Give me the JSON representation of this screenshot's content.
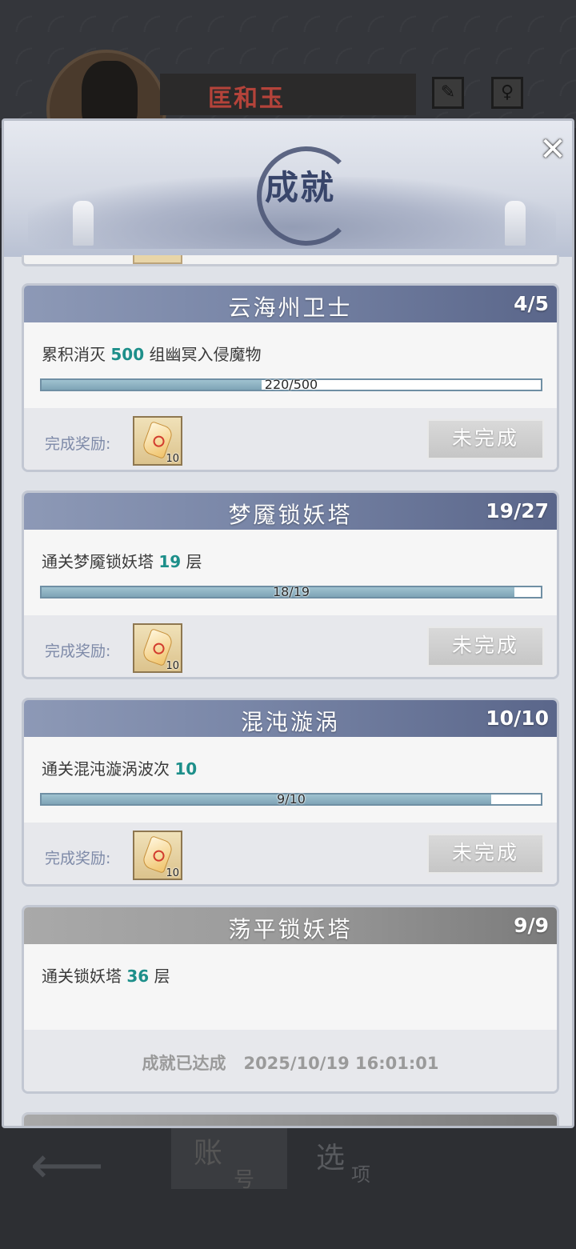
{
  "player": {
    "name": "匡和玉"
  },
  "dialog": {
    "title": "成就",
    "close_label": "✕"
  },
  "achievements": [
    {
      "title": "云海州卫士",
      "progress_count": "4/5",
      "desc_before": "累积消灭 ",
      "desc_number": "500",
      "desc_after": " 组幽冥入侵魔物",
      "progress_value": 220,
      "progress_max": 500,
      "progress_text": "220/500",
      "reward_label": "完成奖励:",
      "reward_qty": "10",
      "status": "未完成"
    },
    {
      "title": "梦魇锁妖塔",
      "progress_count": "19/27",
      "desc_before": "通关梦魇锁妖塔 ",
      "desc_number": "19",
      "desc_after": " 层",
      "progress_value": 18,
      "progress_max": 19,
      "progress_text": "18/19",
      "reward_label": "完成奖励:",
      "reward_qty": "10",
      "status": "未完成"
    },
    {
      "title": "混沌漩涡",
      "progress_count": "10/10",
      "desc_before": "通关混沌漩涡波次 ",
      "desc_number": "10",
      "desc_after": "",
      "progress_value": 9,
      "progress_max": 10,
      "progress_text": "9/10",
      "reward_label": "完成奖励:",
      "reward_qty": "10",
      "status": "未完成"
    },
    {
      "title": "荡平锁妖塔",
      "progress_count": "9/9",
      "desc_before": "通关锁妖塔 ",
      "desc_number": "36",
      "desc_after": " 层",
      "completed_label": "成就已达成",
      "completed_time": "2025/10/19 16:01:01"
    }
  ],
  "bottom_nav": {
    "back_icon": "back-arrow-icon",
    "account_main": "账",
    "account_sub": "号",
    "options_main": "选",
    "options_sub": "项"
  }
}
